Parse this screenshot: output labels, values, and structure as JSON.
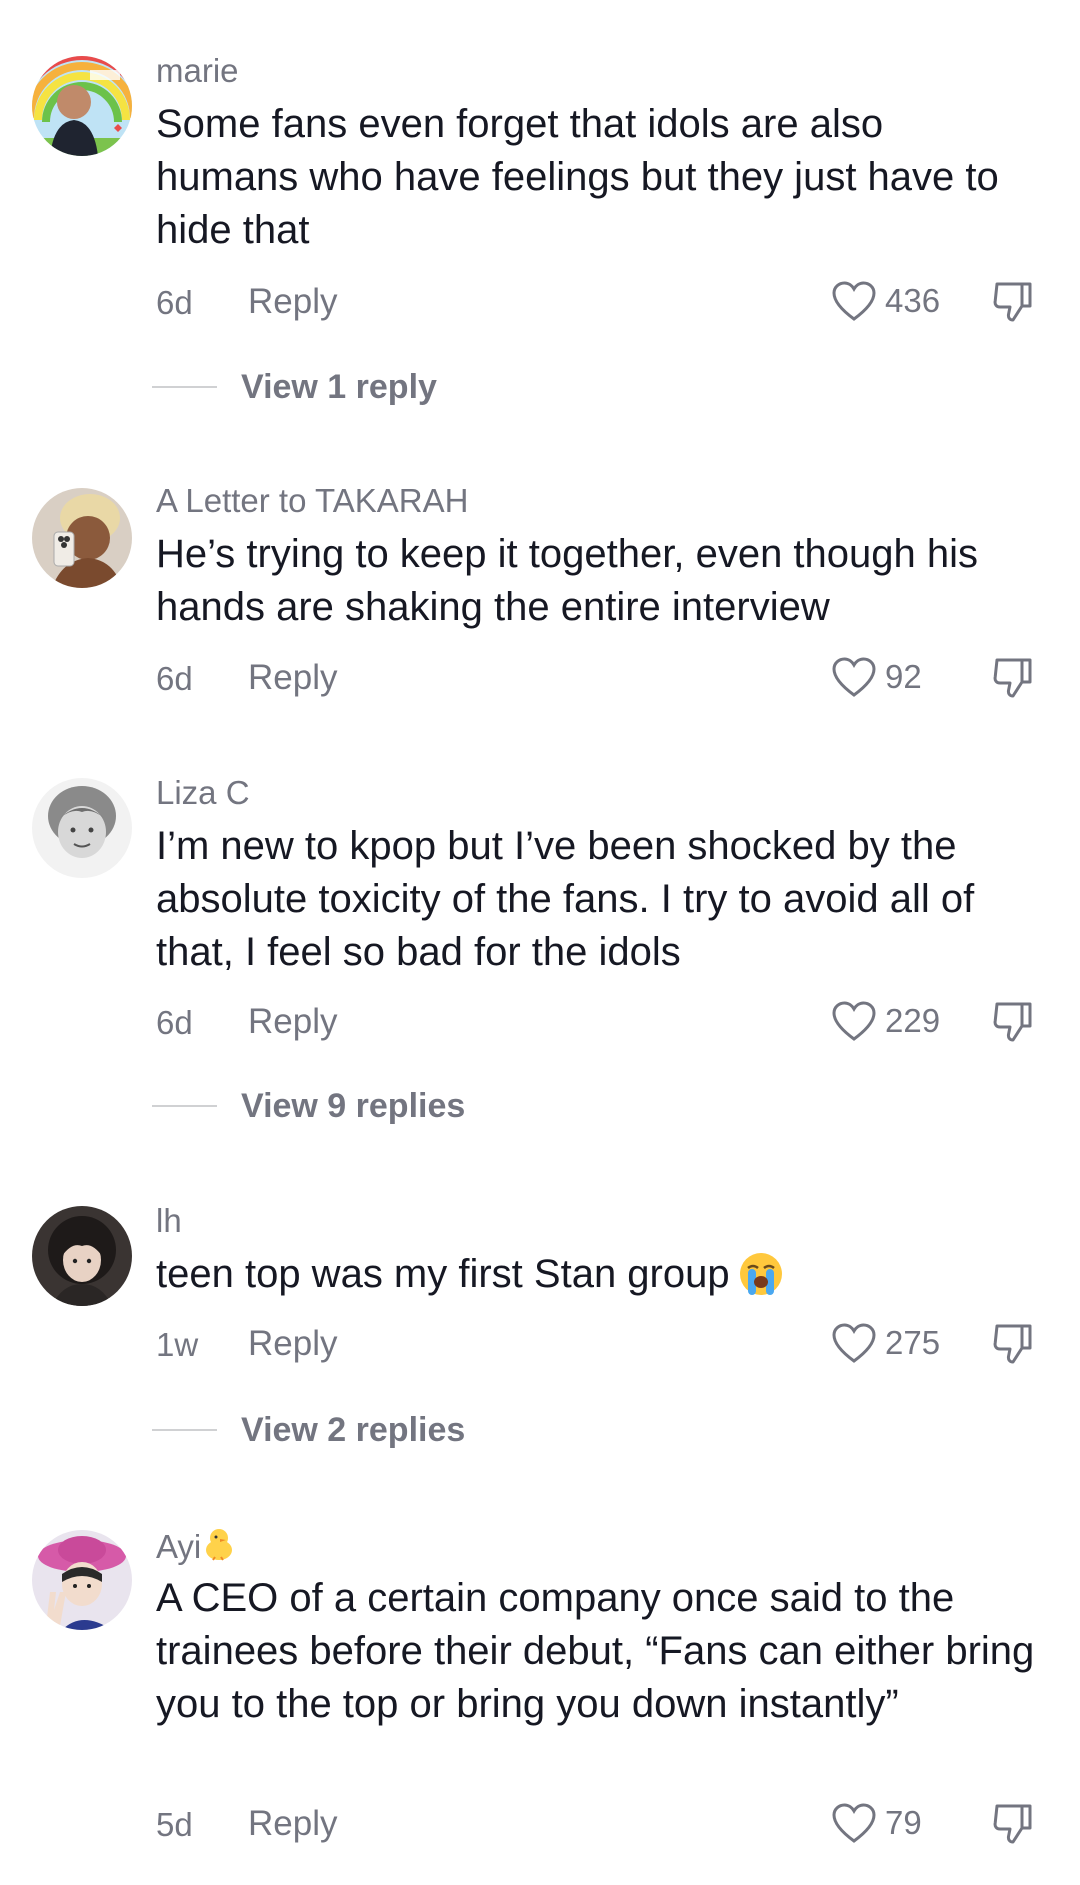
{
  "comments": [
    {
      "username": "marie",
      "text": "Some fans even forget that idols are also humans who have feelings but they just have to hide that",
      "time": "6d",
      "reply_label": "Reply",
      "likes": "436",
      "view_replies": "View 1 reply",
      "avatar_icon": "avatar-man-rainbow-background"
    },
    {
      "username": "A Letter to TAKARAH",
      "text": "He’s trying to keep it together, even though his hands are shaking the entire interview",
      "time": "6d",
      "reply_label": "Reply",
      "likes": "92",
      "avatar_icon": "avatar-mirror-selfie"
    },
    {
      "username": "Liza C",
      "text": "I’m new to kpop but I’ve been shocked by the absolute toxicity of the fans. I try to avoid all of that, I feel so bad for the idols",
      "time": "6d",
      "reply_label": "Reply",
      "likes": "229",
      "view_replies": "View 9 replies",
      "avatar_icon": "avatar-grayscale-portrait"
    },
    {
      "username": "lh",
      "text": "teen top was my first Stan group",
      "text_emoji": "loudly-crying-face",
      "time": "1w",
      "reply_label": "Reply",
      "likes": "275",
      "view_replies": "View 2 replies",
      "avatar_icon": "avatar-dark-hair-portrait"
    },
    {
      "username": "Ayi",
      "username_emoji": "baby-chick",
      "text": "A CEO of a certain company once said to the trainees before their debut, “Fans can either bring you to the top or bring you down instantly”",
      "time": "5d",
      "reply_label": "Reply",
      "likes": "79",
      "avatar_icon": "avatar-pink-hat-peace-sign"
    }
  ],
  "colors": {
    "primary_text": "#161823",
    "secondary_text": "#737580",
    "divider": "#d0d1d3"
  }
}
